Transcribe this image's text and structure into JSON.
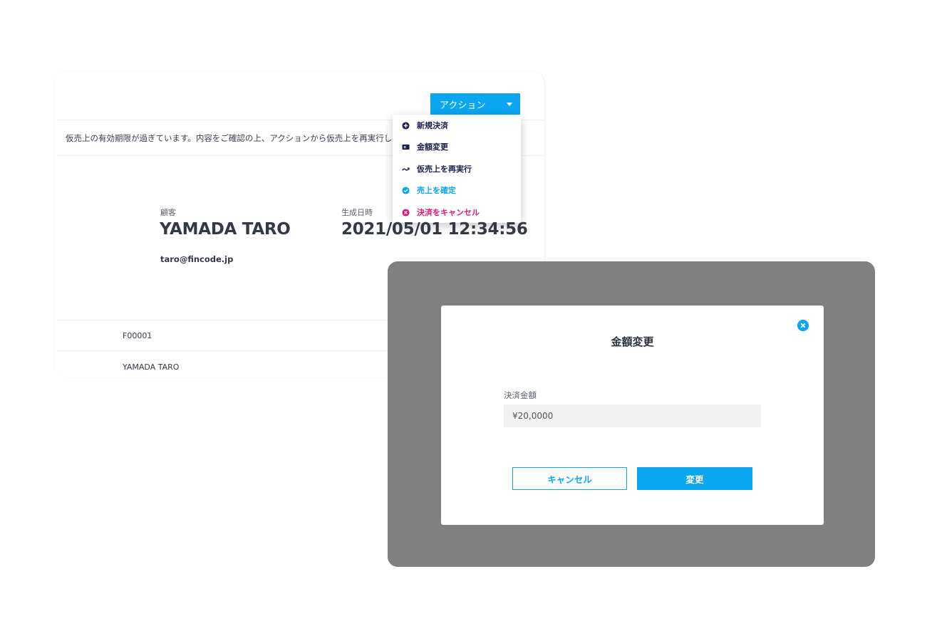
{
  "header": {
    "action_label": "アクション"
  },
  "notice": "仮売上の有効期限が過ぎています。内容をご確認の上、アクションから仮売上を再実行してください",
  "action_menu": {
    "items": [
      {
        "label": "新規決済",
        "icon": "plus-circle-icon",
        "color": "#1a1f4b"
      },
      {
        "label": "金額変更",
        "icon": "yen-card-icon",
        "color": "#1a1f4b"
      },
      {
        "label": "仮売上を再実行",
        "icon": "retry-icon",
        "color": "#1a1f4b"
      },
      {
        "label": "売上を確定",
        "icon": "check-circle-icon",
        "color": "#0aa6f0"
      },
      {
        "label": "決済をキャンセル",
        "icon": "x-circle-icon",
        "color": "#e0187a"
      }
    ]
  },
  "customer": {
    "label": "顧客",
    "name": "YAMADA TARO",
    "email": "taro@fincode.jp"
  },
  "created": {
    "label": "生成日時",
    "value": "2021/05/01 12:34:56"
  },
  "rows": [
    "F00001",
    "YAMADA TARO"
  ],
  "modal": {
    "title": "金額変更",
    "field_label": "決済金額",
    "amount_value": "¥20,0000",
    "cancel_label": "キャンセル",
    "submit_label": "変更"
  },
  "colors": {
    "accent": "#0aa6f0",
    "danger": "#e0187a",
    "navy": "#1a1f4b",
    "overlay": "#808080"
  }
}
